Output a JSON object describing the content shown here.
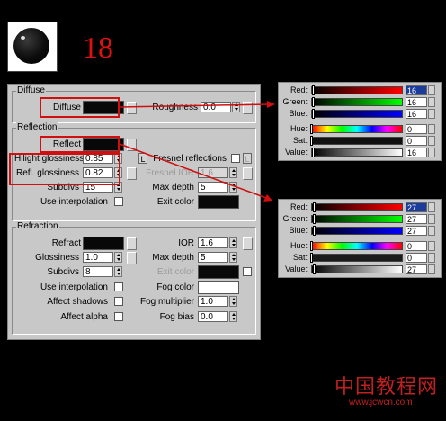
{
  "step_number": "18",
  "diffuse": {
    "title": "Diffuse",
    "diffuse_label": "Diffuse",
    "roughness_label": "Roughness",
    "roughness_value": "0.0"
  },
  "reflection": {
    "title": "Reflection",
    "reflect_label": "Reflect",
    "fresnel_label": "Fresnel reflections",
    "hilight_label": "Hilight glossiness",
    "hilight_value": "0.85",
    "l_button": "L",
    "fresnel_ior_label": "Fresnel IOR",
    "fresnel_ior_value": "1.6",
    "refl_gloss_label": "Refl. glossiness",
    "refl_gloss_value": "0.82",
    "subdivs_label": "Subdivs",
    "subdivs_value": "15",
    "max_depth_label": "Max depth",
    "max_depth_value": "5",
    "use_interp_label": "Use interpolation",
    "exit_color_label": "Exit color"
  },
  "refraction": {
    "title": "Refraction",
    "refract_label": "Refract",
    "ior_label": "IOR",
    "ior_value": "1.6",
    "glossiness_label": "Glossiness",
    "glossiness_value": "1.0",
    "max_depth_label": "Max depth",
    "max_depth_value": "5",
    "subdivs_label": "Subdivs",
    "subdivs_value": "8",
    "exit_color_label": "Exit color",
    "use_interp_label": "Use interpolation",
    "fog_color_label": "Fog color",
    "affect_shadows_label": "Affect shadows",
    "fog_mult_label": "Fog multiplier",
    "fog_mult_value": "1.0",
    "affect_alpha_label": "Affect alpha",
    "fog_bias_label": "Fog bias",
    "fog_bias_value": "0.0"
  },
  "picker_labels": {
    "red": "Red:",
    "green": "Green:",
    "blue": "Blue:",
    "hue": "Hue:",
    "sat": "Sat:",
    "value": "Value:"
  },
  "diffuse_color": {
    "red": "16",
    "green": "16",
    "blue": "16",
    "hue": "0",
    "sat": "0",
    "value": "16"
  },
  "reflect_color": {
    "red": "27",
    "green": "27",
    "blue": "27",
    "hue": "0",
    "sat": "0",
    "value": "27"
  },
  "colors": {
    "accent_red": "#d01010",
    "swatch_black": "#080808"
  },
  "watermark": {
    "text": "中国教程网",
    "url": "www.jcwcn.com"
  }
}
